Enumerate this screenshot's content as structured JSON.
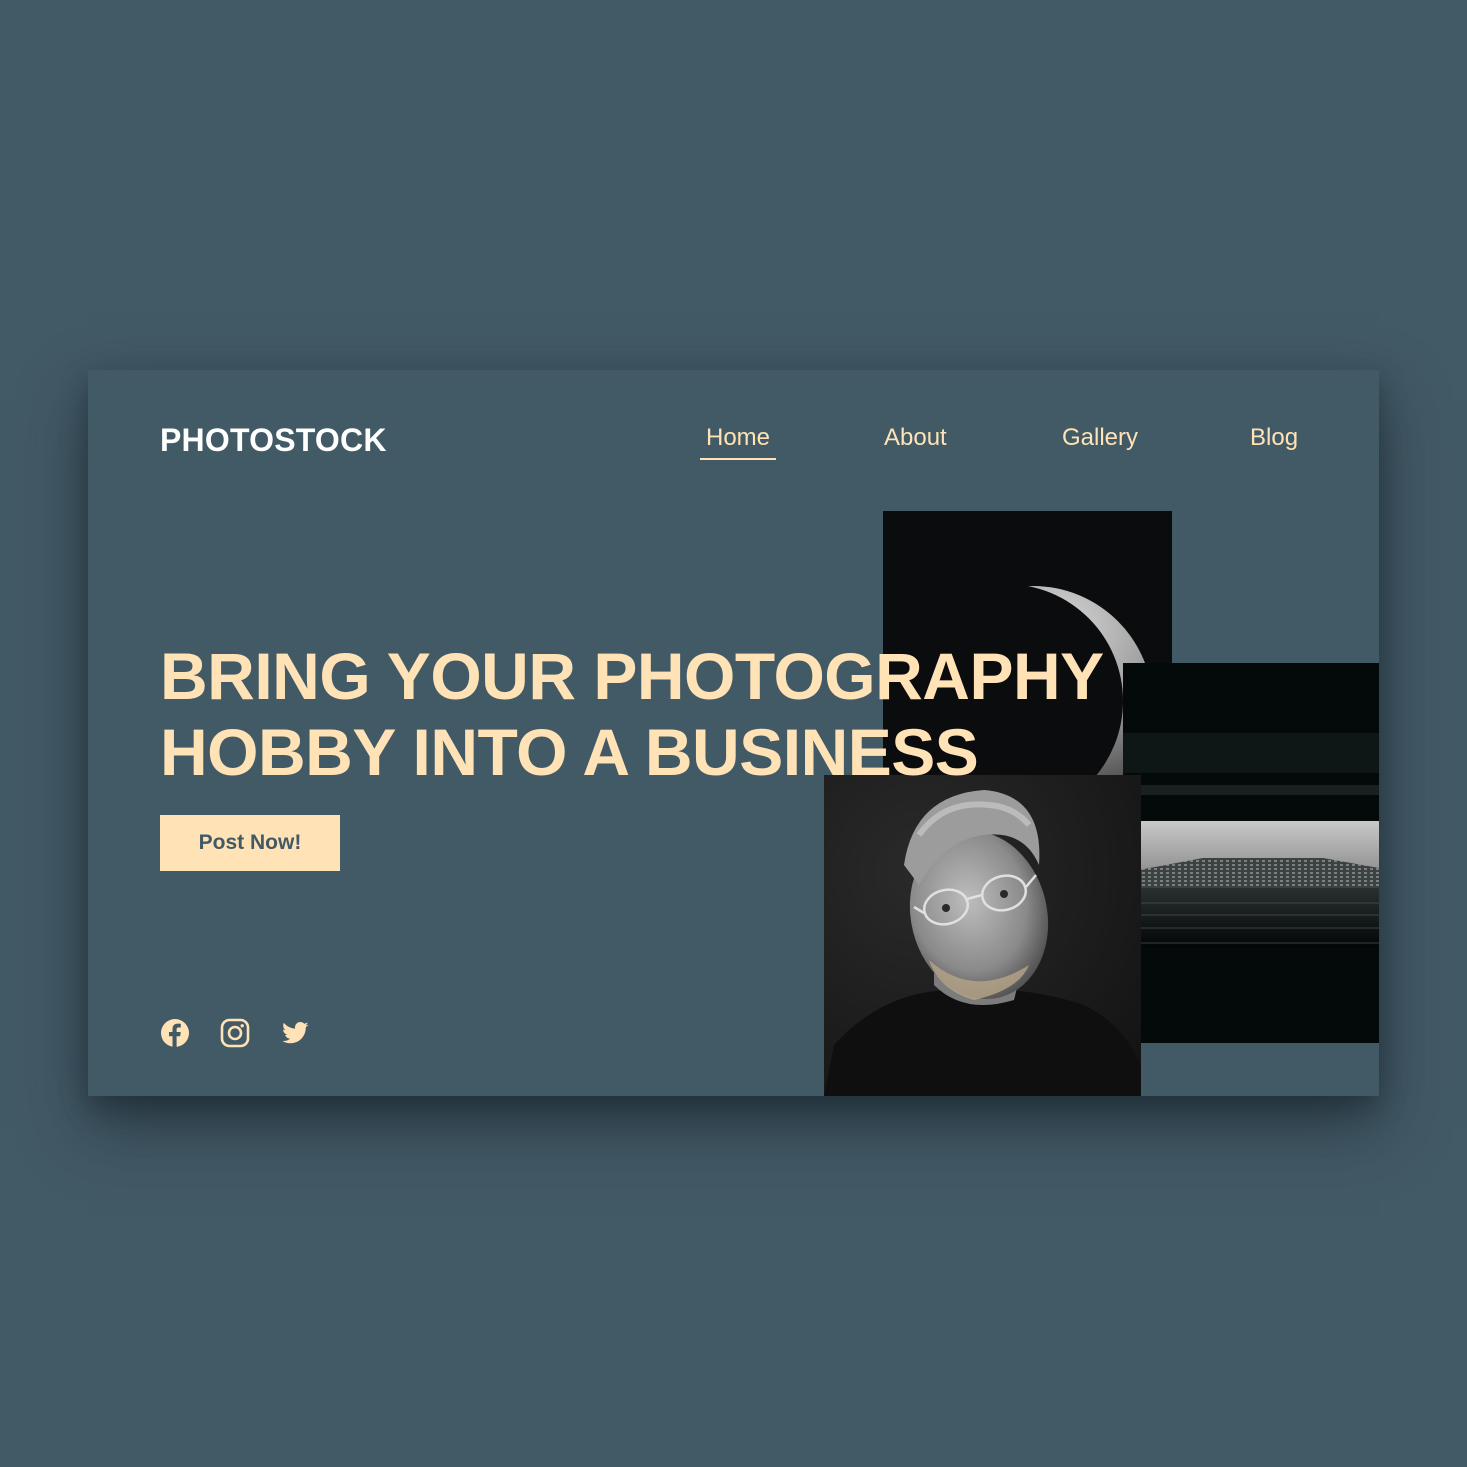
{
  "brand": {
    "logo_text": "PHOTOSTOCK"
  },
  "nav": {
    "items": [
      {
        "label": "Home",
        "active": true
      },
      {
        "label": "About",
        "active": false
      },
      {
        "label": "Gallery",
        "active": false
      },
      {
        "label": "Blog",
        "active": false
      }
    ]
  },
  "hero": {
    "headline_line1": "BRING YOUR PHOTOGRAPHY",
    "headline_line2": "HOBBY INTO A BUSINESS",
    "cta_label": "Post Now!"
  },
  "social": {
    "icons": [
      "facebook-icon",
      "instagram-icon",
      "twitter-icon"
    ]
  },
  "gallery": {
    "images": [
      "crescent moon photo",
      "skyscraper photo",
      "portrait of man with glasses"
    ]
  },
  "colors": {
    "background": "#425a66",
    "accent": "#ffe2b5",
    "logo": "#ffffff"
  }
}
